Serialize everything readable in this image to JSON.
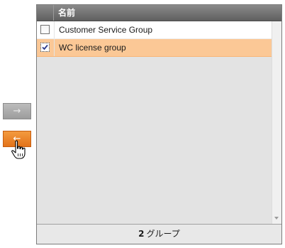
{
  "controls": {
    "add_arrow": "→",
    "remove_arrow": "←"
  },
  "grid": {
    "header": {
      "name": "名前"
    },
    "rows": [
      {
        "label": "Customer Service Group",
        "checked": false,
        "selected": false
      },
      {
        "label": "WC license group",
        "checked": true,
        "selected": true
      }
    ],
    "footer": {
      "count": "2",
      "unit": "グループ"
    }
  },
  "colors": {
    "selected_row": "#fbc896",
    "active_button": "#e3731a",
    "header": "#6e6e6e"
  },
  "icons": {
    "cursor": "hand-pointer-icon",
    "scroll_down": "scroll-down-arrow-icon"
  }
}
